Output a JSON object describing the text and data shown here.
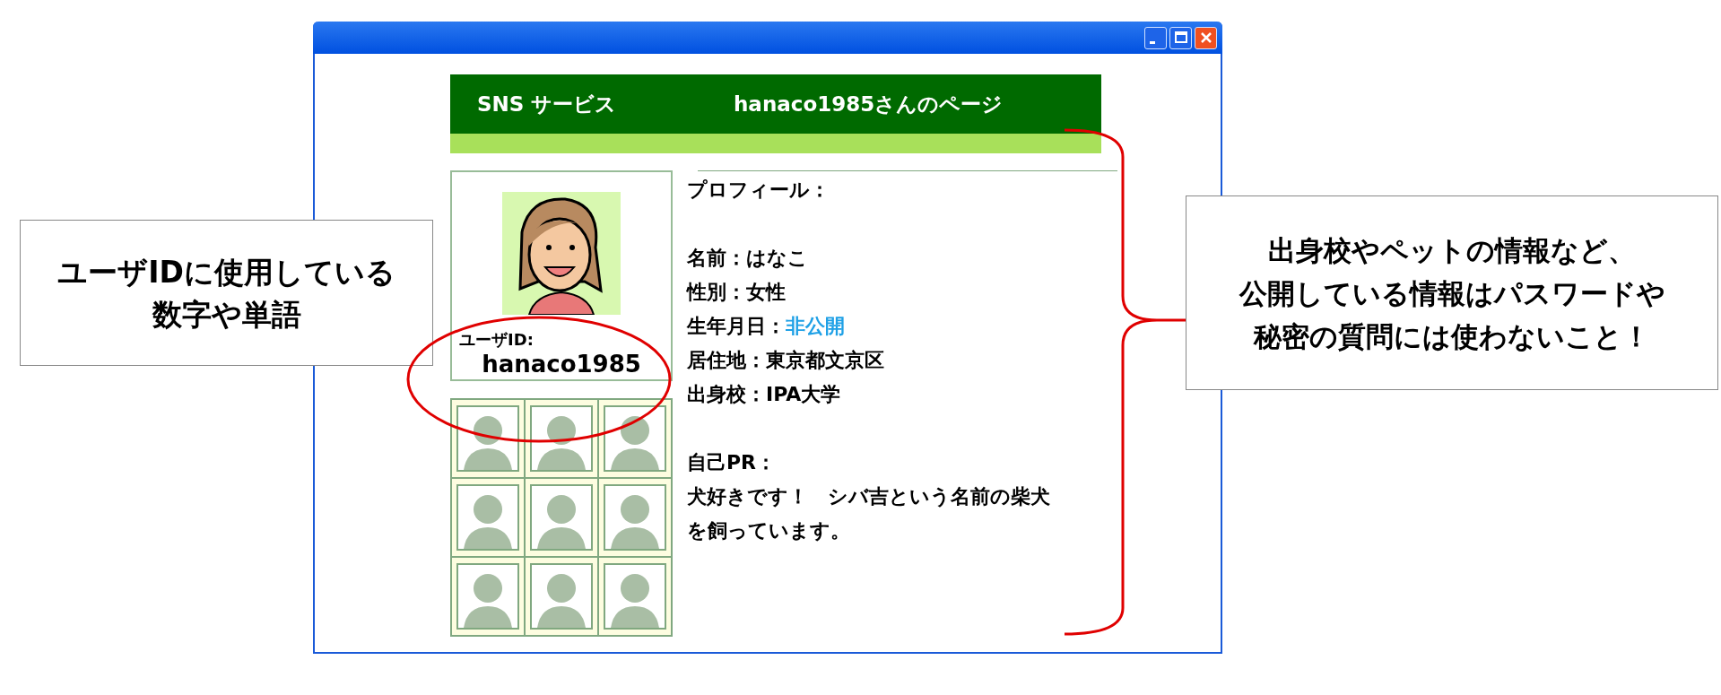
{
  "callouts": [
    {
      "lines": [
        "ユーザIDに使用している",
        "数字や単語"
      ]
    },
    {
      "lines": [
        "出身校やペットの情報など、",
        "公開している情報はパスワードや",
        "秘密の質問には使わないこと！"
      ]
    }
  ],
  "window": {
    "controls": [
      {
        "kind": "minimize"
      },
      {
        "kind": "maximize"
      },
      {
        "kind": "close"
      }
    ]
  },
  "header": {
    "service_name": "SNS サービス",
    "page_title": "hanaco1985さんのページ"
  },
  "profile_card": {
    "id_label": "ユーザID:",
    "user_id": "hanaco1985"
  },
  "profile": {
    "heading": "プロフィール：",
    "fields": [
      {
        "label": "名前：",
        "value": "はなこ",
        "private": false
      },
      {
        "label": "性別：",
        "value": "女性",
        "private": false
      },
      {
        "label": "生年月日：",
        "value": "非公開",
        "private": true
      },
      {
        "label": "居住地：",
        "value": "東京都文京区",
        "private": false
      },
      {
        "label": "出身校：",
        "value": "IPA大学",
        "private": false
      }
    ],
    "pr_heading": "自己PR：",
    "pr_lines": [
      "犬好きです！　シバ吉という名前の柴犬",
      "を飼っています。"
    ]
  }
}
